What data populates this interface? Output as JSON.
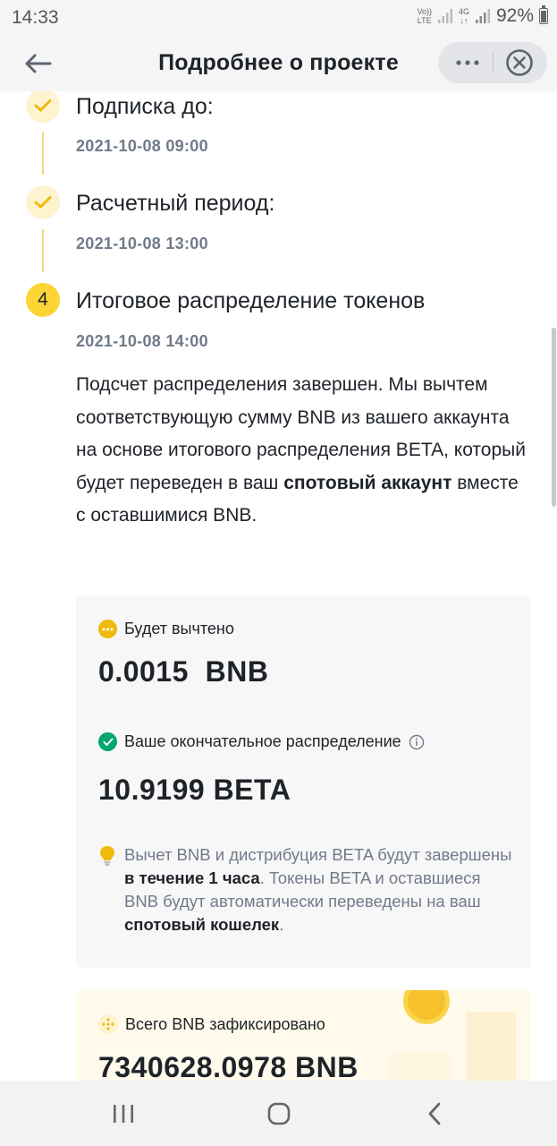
{
  "status_bar": {
    "time": "14:33",
    "volte_line1": "Vo))",
    "volte_line2": "LTE",
    "net_line1": "4G",
    "net_line2": "↓↑",
    "battery": "92%"
  },
  "header": {
    "title": "Подробнее о проекте",
    "icons": {
      "back": "arrow-left-icon",
      "more": "more-dots-icon",
      "close": "close-circle-icon"
    }
  },
  "steps": [
    {
      "title": "Подписка до:",
      "date": "2021-10-08 09:00",
      "status": "done"
    },
    {
      "title": "Расчетный период:",
      "date": "2021-10-08 13:00",
      "status": "done"
    },
    {
      "number": "4",
      "title": "Итоговое распределение токенов",
      "date": "2021-10-08 14:00",
      "status": "active",
      "desc_part1": "Подсчет распределения завершен. Мы вычтем соответствующую сумму BNB из вашего аккаунта на основе итогового распределения BETA, который будет переведен в ваш ",
      "desc_bold": "спотовый аккаунт",
      "desc_part2": " вместе с оставшимися BNB."
    }
  ],
  "summary_card": {
    "deducted_label": "Будет вычтено",
    "deducted_value": "0.0015  BNB",
    "final_label": "Ваше окончательное распределение",
    "final_value": "10.9199 BETA",
    "note_part1": "Вычет BNB и дистрибуция BETA будут завершены ",
    "note_bold1": "в течение 1 часа",
    "note_part2": ". Токены BETA и оставшиеся BNB будут автоматически переведены на ваш ",
    "note_bold2": "спотовый кошелек",
    "note_part3": "."
  },
  "total_card": {
    "label": "Всего BNB зафиксировано",
    "value": "7340628.0978 BNB"
  },
  "nav": {
    "recent": "recent-apps-icon",
    "home": "home-icon",
    "back": "back-icon"
  },
  "colors": {
    "accent": "#fcd535",
    "accent_soft": "#fdf3cf",
    "check": "#f0b90b",
    "success": "#03a66d",
    "text_primary": "#1e2329",
    "text_secondary": "#707a8a",
    "card_bg": "#f7f7f7"
  }
}
